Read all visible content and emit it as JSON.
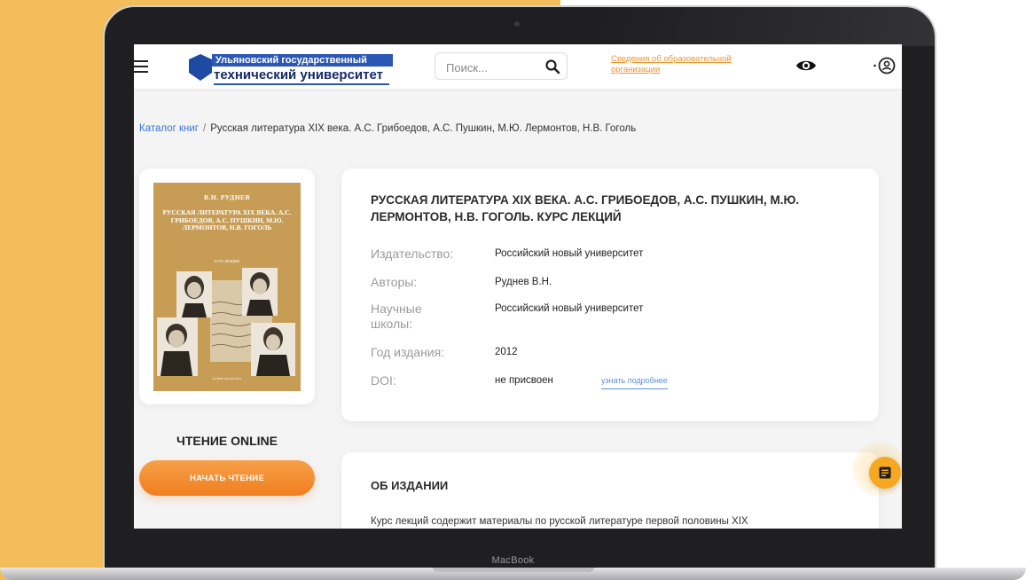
{
  "device": {
    "brand_label": "MacBook"
  },
  "header": {
    "logo_line1": "Ульяновский государственный",
    "logo_line2": "технический университет",
    "search_placeholder": "Поиск...",
    "org_link": "Сведения об образовательной организации"
  },
  "breadcrumb": {
    "catalog": "Каталог книг",
    "separator": "/",
    "current": "Русская литература XIX века. А.С. Грибоедов, А.С. Пушкин, М.Ю. Лермонтов, Н.В. Гоголь"
  },
  "cover": {
    "author": "В.Н. РУДНЕВ",
    "title": "РУССКАЯ ЛИТЕРАТУРА XIX ВЕКА. А.С. ГРИБОЕДОВ, А.С. ПУШКИН, М.Ю. ЛЕРМОНТОВ, Н.В. ГОГОЛЬ",
    "subtitle": "КУРС ЛЕКЦИЙ",
    "footer": "РосНОУ Москва 2012"
  },
  "reading": {
    "title": "ЧТЕНИЕ ONLINE",
    "button": "НАЧАТЬ ЧТЕНИЕ"
  },
  "book": {
    "title": "Русская литература XIX века. А.С. Грибоедов, А.С. Пушкин, М.Ю. Лермонтов, Н.В. Гоголь. Курс лекций",
    "fields": [
      {
        "label": "Издательство:",
        "value": "Российский новый университет"
      },
      {
        "label": "Авторы:",
        "value": "Руднев В.Н."
      },
      {
        "label": "Научные школы:",
        "value": "Российский новый университет"
      },
      {
        "label": "Год издания:",
        "value": "2012"
      },
      {
        "label": "DOI:",
        "value": "не присвоен"
      }
    ],
    "doi_link": "узнать подробнее"
  },
  "about": {
    "title": "ОБ ИЗДАНИИ",
    "text": "Курс лекций содержит материалы по русской литературе первой половины XIX"
  },
  "colors": {
    "accent_orange": "#f07e1e",
    "link_blue": "#3b73d9",
    "backdrop_yellow": "#f4bd5b",
    "float_yellow": "#f6a821"
  },
  "icons": [
    "hamburger-icon",
    "search-icon",
    "eye-icon",
    "user-icon",
    "notes-icon"
  ]
}
